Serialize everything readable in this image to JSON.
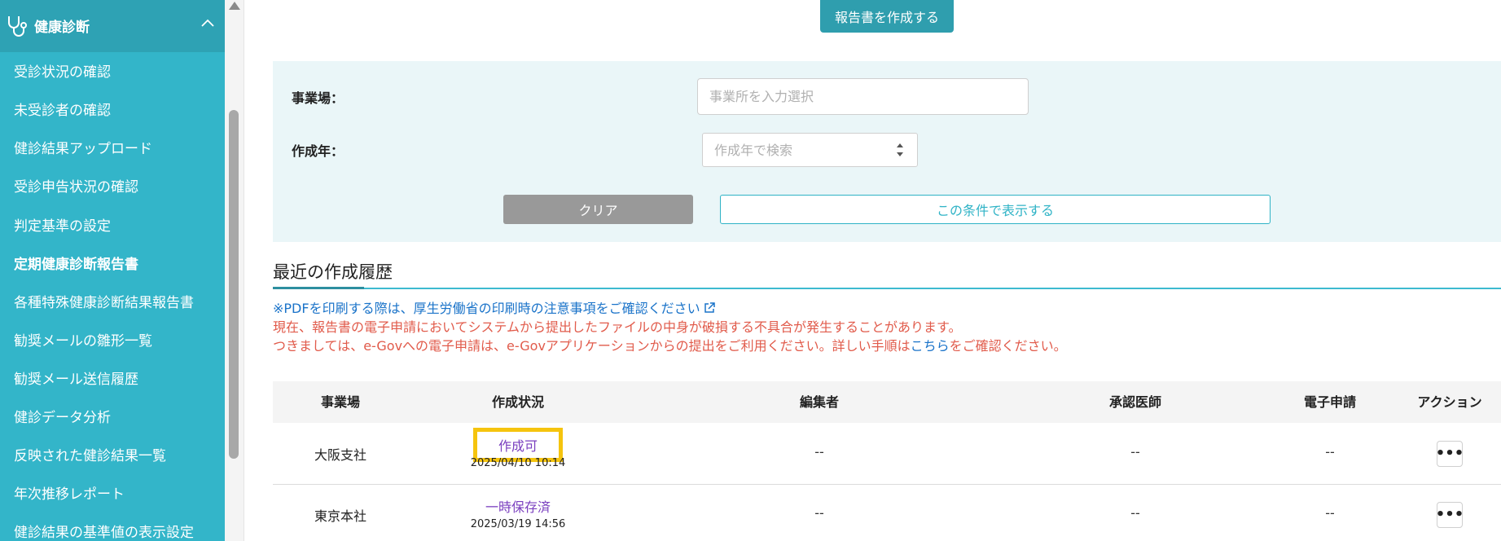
{
  "sidebar": {
    "section_title": "健康診断",
    "section_icon": "stethoscope-icon",
    "items": [
      {
        "label": "受診状況の確認"
      },
      {
        "label": "未受診者の確認"
      },
      {
        "label": "健診結果アップロード"
      },
      {
        "label": "受診申告状況の確認"
      },
      {
        "label": "判定基準の設定"
      },
      {
        "label": "定期健康診断報告書",
        "active": true
      },
      {
        "label": "各種特殊健康診断結果報告書"
      },
      {
        "label": "勧奨メールの雛形一覧"
      },
      {
        "label": "勧奨メール送信履歴"
      },
      {
        "label": "健診データ分析"
      },
      {
        "label": "反映された健診結果一覧"
      },
      {
        "label": "年次推移レポート"
      },
      {
        "label": "健診結果の基準値の表示設定"
      }
    ]
  },
  "header": {
    "create_button": "報告書を作成する"
  },
  "filter": {
    "office_label": "事業場：",
    "office_placeholder": "事業所を入力選択",
    "year_label": "作成年：",
    "year_placeholder": "作成年で検索",
    "clear_button": "クリア",
    "show_button": "この条件で表示する"
  },
  "history": {
    "title": "最近の作成履歴",
    "print_note": "※PDFを印刷する際は、厚生労働省の印刷時の注意事項をご確認ください",
    "warning_line1": "現在、報告書の電子申請においてシステムから提出したファイルの中身が破損する不具合が発生することがあります。",
    "warning_line2_before": "つきましては、e-Govへの電子申請は、e-Govアプリケーションからの提出をご利用ください。詳しい手順は",
    "warning_line2_link": "こちら",
    "warning_line2_after": "をご確認ください。"
  },
  "table": {
    "headers": [
      "事業場",
      "作成状況",
      "編集者",
      "承認医師",
      "電子申請",
      "アクション"
    ],
    "rows": [
      {
        "office": "大阪支社",
        "status": "作成可",
        "date": "2025/04/10 10:14",
        "editor": "--",
        "doctor": "--",
        "e_filing": "--",
        "action": "•••"
      },
      {
        "office": "東京本社",
        "status": "一時保存済",
        "date": "2025/03/19 14:56",
        "editor": "--",
        "doctor": "--",
        "e_filing": "--",
        "action": "•••"
      }
    ]
  },
  "colors": {
    "sidebar_bg": "#33b5c9",
    "sidebar_head_bg": "#2ea2b4",
    "accent": "#2f9eae",
    "status_purple": "#7a3fbf",
    "highlight": "#f5c40e",
    "warning_red": "#e15b4b",
    "link_blue": "#1a73c9"
  }
}
